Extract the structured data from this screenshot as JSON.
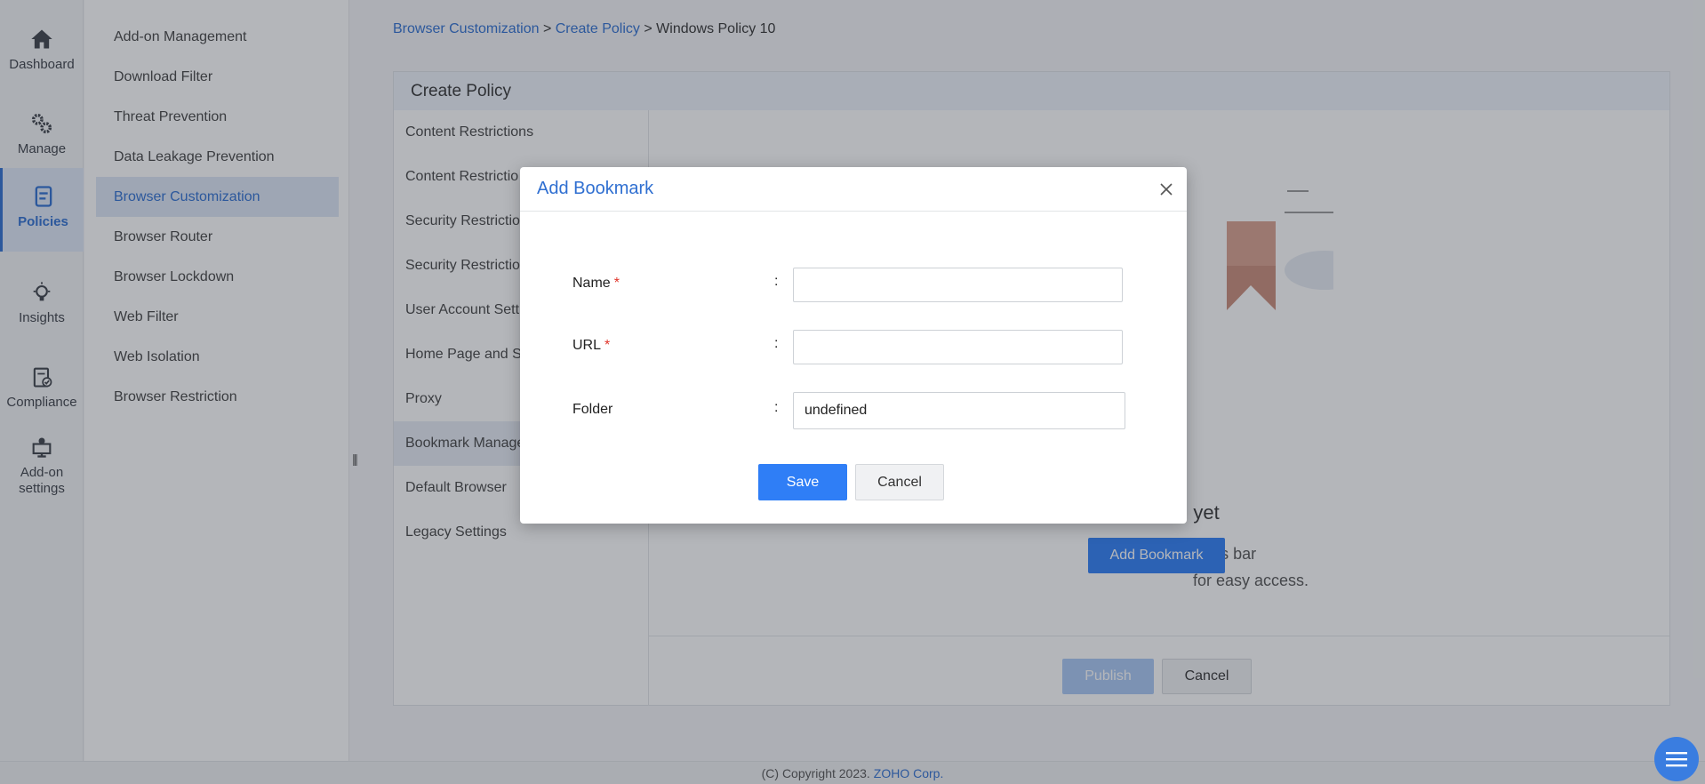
{
  "rail": {
    "items": [
      {
        "label": "Dashboard",
        "icon": "home-icon"
      },
      {
        "label": "Manage",
        "icon": "gears-icon"
      },
      {
        "label": "Policies",
        "icon": "policies-icon",
        "active": true
      },
      {
        "label": "Insights",
        "icon": "lightbulb-icon"
      },
      {
        "label": "Compliance",
        "icon": "clipboard-check-icon"
      },
      {
        "label": "Add-on settings",
        "icon": "addon-settings-icon"
      }
    ]
  },
  "submenu": {
    "items": [
      {
        "label": "Add-on Management"
      },
      {
        "label": "Download Filter"
      },
      {
        "label": "Threat Prevention"
      },
      {
        "label": "Data Leakage Prevention"
      },
      {
        "label": "Browser Customization",
        "active": true
      },
      {
        "label": "Browser Router"
      },
      {
        "label": "Browser Lockdown"
      },
      {
        "label": "Web Filter"
      },
      {
        "label": "Web Isolation"
      },
      {
        "label": "Browser Restriction"
      }
    ]
  },
  "breadcrumb": {
    "crumb1": "Browser Customization",
    "sep": ">",
    "crumb2": "Create Policy",
    "current": "Windows Policy 10"
  },
  "panel": {
    "title": "Create Policy",
    "tabs": [
      {
        "label": "Content Restrictions"
      },
      {
        "label": "Content Restrictio"
      },
      {
        "label": "Security Restrictio"
      },
      {
        "label": "Security Restrictio"
      },
      {
        "label": "User Account Sett"
      },
      {
        "label": "Home Page and St"
      },
      {
        "label": "Proxy"
      },
      {
        "label": "Bookmark Manage",
        "active": true
      },
      {
        "label": "Default Browser"
      },
      {
        "label": "Legacy Settings"
      }
    ],
    "empty_title": "been added yet",
    "empty_desc_line1": "s to the bookmarks bar",
    "empty_desc_line2": "for easy access.",
    "add_bookmark_label": "Add Bookmark",
    "publish_label": "Publish",
    "cancel_label": "Cancel"
  },
  "modal": {
    "title": "Add Bookmark",
    "fields": {
      "name_label": "Name",
      "url_label": "URL",
      "folder_label": "Folder",
      "required_mark": "*",
      "colon": ":",
      "name_value": "",
      "url_value": "",
      "folder_value": "undefined"
    },
    "save_label": "Save",
    "cancel_label": "Cancel"
  },
  "footer": {
    "copyright": "(C) Copyright 2023.",
    "company": "ZOHO Corp."
  },
  "colors": {
    "accent": "#2f7ef6",
    "link": "#2f6fd1",
    "required": "#e0342a"
  }
}
